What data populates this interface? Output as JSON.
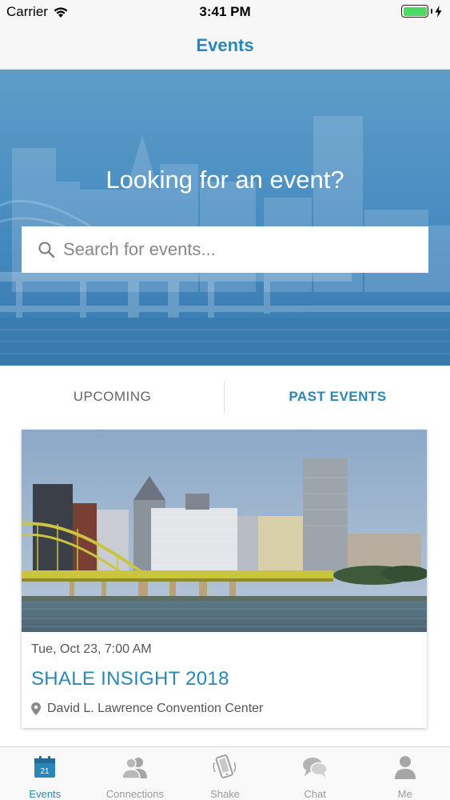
{
  "status_bar": {
    "carrier": "Carrier",
    "time": "3:41 PM",
    "battery_level": 1.0
  },
  "nav": {
    "title": "Events"
  },
  "hero": {
    "heading": "Looking for an event?",
    "search_placeholder": "Search for events..."
  },
  "tabs": {
    "upcoming": "UPCOMING",
    "past": "PAST EVENTS",
    "selected": "past"
  },
  "event": {
    "date": "Tue, Oct 23, 7:00 AM",
    "title": "SHALE INSIGHT 2018",
    "location": "David L. Lawrence Convention Center"
  },
  "tab_bar": {
    "items": [
      {
        "label": "Events",
        "icon": "calendar-icon",
        "active": true,
        "badge_text": "21"
      },
      {
        "label": "Connections",
        "icon": "people-icon",
        "active": false
      },
      {
        "label": "Shake",
        "icon": "phone-shake-icon",
        "active": false
      },
      {
        "label": "Chat",
        "icon": "chat-bubbles-icon",
        "active": false
      },
      {
        "label": "Me",
        "icon": "person-icon",
        "active": false
      }
    ]
  },
  "colors": {
    "accent": "#2a86b6",
    "hero_overlay": "#4a8ec2",
    "inactive": "#9a9a9a"
  }
}
